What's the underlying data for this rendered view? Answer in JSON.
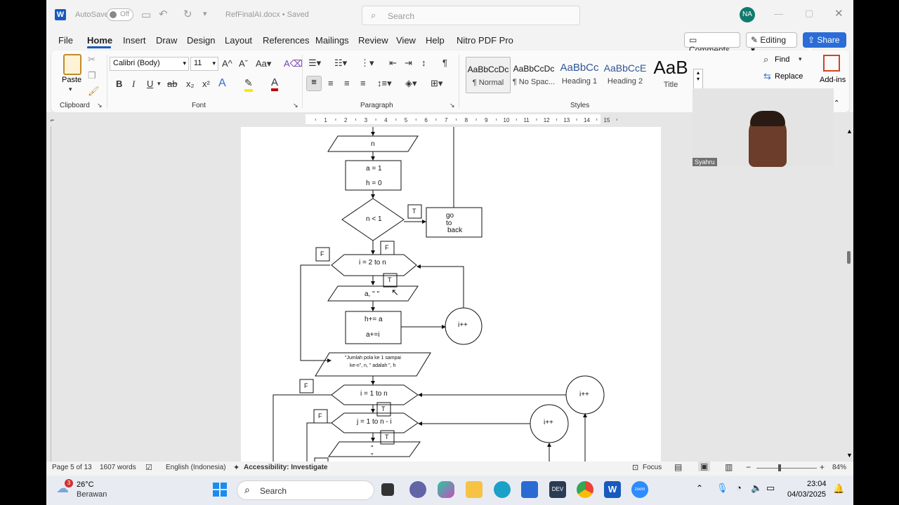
{
  "titlebar": {
    "autosave_label": "AutoSave",
    "autosave_state": "Off",
    "doc_title": "RefFinalAI.docx • Saved",
    "search_placeholder": "Search",
    "avatar_initials": "NA"
  },
  "menu": [
    "File",
    "Home",
    "Insert",
    "Draw",
    "Design",
    "Layout",
    "References",
    "Mailings",
    "Review",
    "View",
    "Help",
    "Nitro PDF Pro"
  ],
  "actions": {
    "comments": "Comments",
    "editing": "Editing",
    "share": "Share"
  },
  "ribbon": {
    "clipboard_label": "Clipboard",
    "paste_label": "Paste",
    "font_label": "Font",
    "font_name": "Calibri (Body)",
    "font_size": "11",
    "paragraph_label": "Paragraph",
    "styles_label": "Styles",
    "styles": [
      {
        "sample": "AaBbCcDc",
        "name": "¶ Normal"
      },
      {
        "sample": "AaBbCcDc",
        "name": "¶ No Spac..."
      },
      {
        "sample": "AaBbCc",
        "name": "Heading 1"
      },
      {
        "sample": "AaBbCcE",
        "name": "Heading 2"
      },
      {
        "sample": "AaB",
        "name": "Title"
      }
    ],
    "find_label": "Find",
    "replace_label": "Replace",
    "addins_label": "Add-ins"
  },
  "ruler_numbers": [
    "1",
    "2",
    "3",
    "4",
    "5",
    "6",
    "7",
    "8",
    "9",
    "10",
    "11",
    "12",
    "13",
    "14",
    "15"
  ],
  "flowchart": {
    "n_input": "n",
    "init_a": "a = 1",
    "init_h": "h = 0",
    "cond": "n < 1",
    "t1": "T",
    "goto_1": "go to",
    "goto_2": "back",
    "f1": "F",
    "f2": "F",
    "loop1": "i = 2 to n",
    "t2": "T",
    "out1": "a, \" \"",
    "calc_h": "h+= a",
    "calc_a": "a+=i",
    "inc1": "i++",
    "out2_1": "\"Jumlah pola ke 1 sampai",
    "out2_2": "ke-n\", n, \" adalah \", h",
    "f3": "F",
    "loop2": "i = 1 to n",
    "inc2": "i++",
    "t3": "T",
    "f4": "F",
    "loop3": "j = 1 to n - i",
    "inc3": "i++",
    "t4": "T",
    "out3": "\" \""
  },
  "webcam": {
    "name": "Syahru"
  },
  "status": {
    "page": "Page 5 of 13",
    "words": "1607 words",
    "language": "English (Indonesia)",
    "accessibility": "Accessibility: Investigate",
    "focus": "Focus",
    "zoom": "84%"
  },
  "taskbar": {
    "temp": "26°C",
    "weather": "Berawan",
    "weather_badge": "3",
    "search_placeholder": "Search",
    "time": "23:04",
    "date": "04/03/2025"
  },
  "colors": {
    "accent": "#185abd",
    "avatar": "#0f7b6c",
    "share": "#2b6cd6"
  }
}
